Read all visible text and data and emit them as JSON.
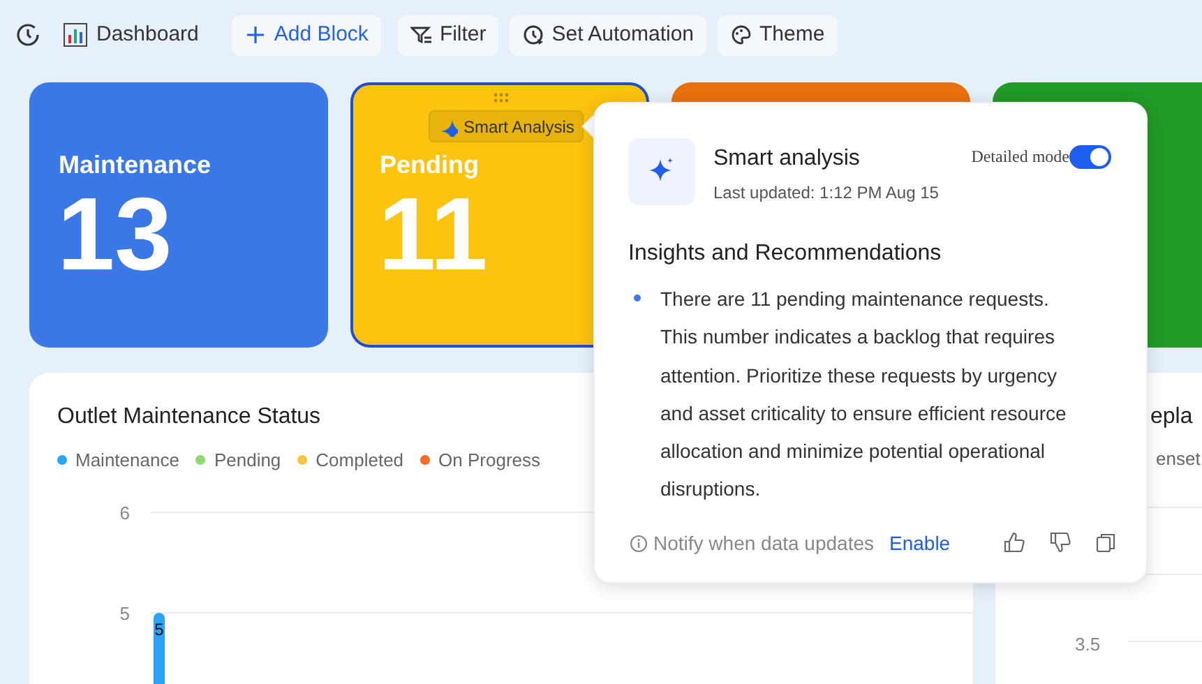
{
  "toolbar": [
    {
      "kind": "title",
      "label": "Dashboard"
    },
    {
      "kind": "primary",
      "label": "Add Block"
    },
    {
      "kind": "button",
      "label": "Filter"
    },
    {
      "kind": "button",
      "label": "Set Automation"
    },
    {
      "kind": "button",
      "label": "Theme"
    }
  ],
  "cards": [
    {
      "title": "Maintenance",
      "value": "13",
      "color": "#3b78e7",
      "selected": false
    },
    {
      "title": "Pending",
      "value": "11",
      "color": "#fcc40f",
      "selected": true,
      "chip": "Smart Analysis"
    },
    {
      "color": "#e8700f",
      "selected": false
    },
    {
      "color": "#229a26",
      "selected": false
    }
  ],
  "panels": [
    {
      "title": "Outlet Maintenance Status",
      "chart_data": {
        "type": "bar",
        "ylim": [
          4.2,
          6
        ],
        "yticks": [
          5,
          6
        ],
        "data_labels": true,
        "series": [
          {
            "name": "Maintenance",
            "color": "#2aa5f5",
            "values": [
              5
            ]
          },
          {
            "name": "Pending",
            "color": "#8fd96f",
            "values": [
              null
            ]
          },
          {
            "name": "Completed",
            "color": "#fcc43c",
            "values": [
              null
            ]
          },
          {
            "name": "On Progress",
            "color": "#f96a23",
            "values": [
              null
            ]
          }
        ]
      }
    },
    {
      "title": "epla",
      "legend": [
        "enset"
      ],
      "tick": "3.5"
    }
  ],
  "popover": {
    "title": "Smart analysis",
    "updated": "Last updated: 1:12 PM Aug 15",
    "mode_label": "Detailed mode",
    "mode_on": true,
    "heading": "Insights and Recommendations",
    "bullets": [
      "There are 11 pending maintenance requests. This number indicates a backlog that requires attention. Prioritize these requests by urgency and asset criticality to ensure efficient resource allocation and minimize potential operational disruptions."
    ],
    "notify": "Notify when data updates",
    "enable": "Enable"
  }
}
